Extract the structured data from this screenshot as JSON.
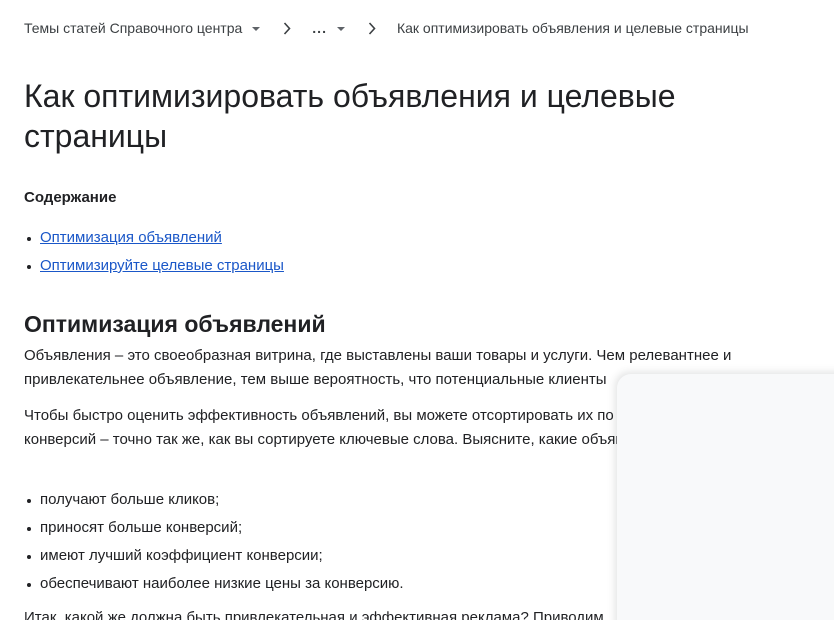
{
  "breadcrumb": {
    "items": [
      {
        "label": "Темы статей Справочного центра"
      },
      {
        "label": "..."
      }
    ],
    "current": "Как оптимизировать объявления и целевые страницы"
  },
  "article": {
    "title": "Как оптимизировать объявления и целевые страницы",
    "toc": {
      "heading": "Содержание",
      "links": [
        "Оптимизация объявлений",
        "Оптимизируйте целевые страницы"
      ]
    },
    "section1": {
      "heading": "Оптимизация объявлений",
      "p1": "Объявления – это своеобразная витрина, где выставлены ваши товары и услуги. Чем релевантнее и привлекательнее объявление, тем выше вероятность, что потенциальные клиенты",
      "p2": "Чтобы быстро оценить эффективность объявлений, вы можете отсортировать их по CTR или статистике конверсий – точно так же, как вы сортируете ключевые слова. Выясните, какие объявления...",
      "bullets": [
        "получают больше кликов;",
        "приносят больше конверсий;",
        "имеют лучший коэффициент конверсии;",
        "обеспечивают наиболее низкие цены за конверсию."
      ],
      "p3": "Итак, какой же должна быть привлекательная и эффективная реклама? Приводим"
    }
  },
  "colors": {
    "link": "#1a57c8",
    "text": "#202124",
    "overlay": "#f8f9fa"
  }
}
